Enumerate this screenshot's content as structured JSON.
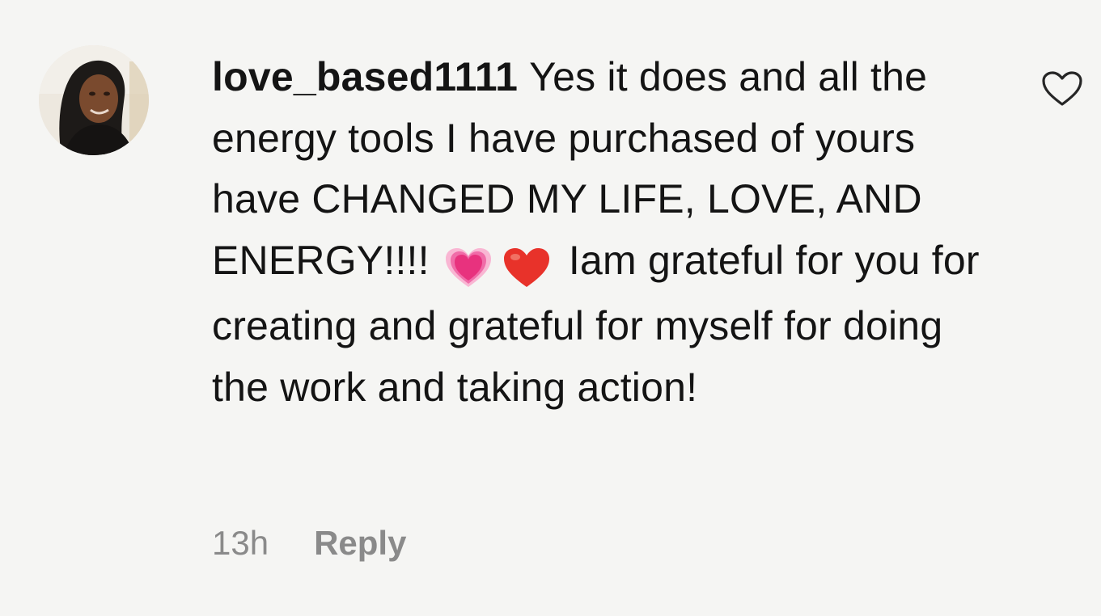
{
  "comment": {
    "username": "love_based1111",
    "text_before_emoji": "Yes it does and all the energy tools I have purchased of yours have CHANGED MY LIFE, LOVE, AND ENERGY!!!!",
    "emoji": [
      "growing-heart-icon",
      "red-heart-icon"
    ],
    "text_after_emoji": "Iam grateful for you for creating and grateful for myself for doing the work and taking action!",
    "timestamp": "13h",
    "reply_label": "Reply",
    "like_icon": "heart-outline-icon"
  },
  "colors": {
    "text": "#141414",
    "meta_text": "#8a8a8a",
    "background": "#f5f5f3",
    "pink_heart": "#f0478f",
    "red_heart": "#e8322a"
  }
}
